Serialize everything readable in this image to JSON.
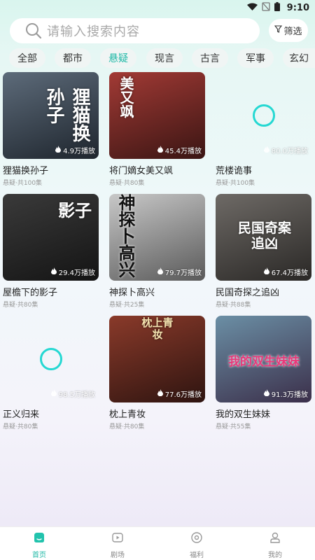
{
  "status_bar": {
    "time": "9:10"
  },
  "search": {
    "placeholder": "请输入搜索内容"
  },
  "filter": {
    "label": "筛选"
  },
  "tabs": [
    {
      "label": "全部"
    },
    {
      "label": "都市"
    },
    {
      "label": "悬疑",
      "active": true
    },
    {
      "label": "现言"
    },
    {
      "label": "古言"
    },
    {
      "label": "军事"
    },
    {
      "label": "玄幻"
    }
  ],
  "dramas": [
    {
      "title": "狸猫换孙子",
      "meta": "悬疑·共100集",
      "plays": "4.9万播放",
      "poster_text": "狸猫换孙子",
      "colors": [
        "#5d6b7a",
        "#1e252d"
      ]
    },
    {
      "title": "将门嫡女美又飒",
      "meta": "悬疑·共80集",
      "plays": "45.4万播放",
      "poster_text": "美又飒",
      "colors": [
        "#a23a35",
        "#3a1513"
      ]
    },
    {
      "title": "荒楼诡事",
      "meta": "悬疑·共100集",
      "plays": "80.0万播放",
      "poster_text": "",
      "loading": true
    },
    {
      "title": "屋檐下的影子",
      "meta": "悬疑·共80集",
      "plays": "29.4万播放",
      "poster_text": "影子",
      "colors": [
        "#3a3a3a",
        "#141414"
      ]
    },
    {
      "title": "神探卜高兴",
      "meta": "悬疑·共25集",
      "plays": "79.7万播放",
      "poster_text": "神探卜高兴",
      "colors": [
        "#c8c8c8",
        "#5a5a5a"
      ]
    },
    {
      "title": "民国奇探之追凶",
      "meta": "悬疑·共88集",
      "plays": "67.4万播放",
      "poster_text": "民国奇案 追凶",
      "colors": [
        "#6e6a66",
        "#2a2826"
      ]
    },
    {
      "title": "正义归来",
      "meta": "悬疑·共80集",
      "plays": "98.5万播放",
      "poster_text": "",
      "loading": true
    },
    {
      "title": "枕上青妆",
      "meta": "悬疑·共80集",
      "plays": "77.6万播放",
      "poster_text": "枕上青妆",
      "colors": [
        "#8a3a2a",
        "#2e1410"
      ]
    },
    {
      "title": "我的双生妹妹",
      "meta": "悬疑·共55集",
      "plays": "91.3万播放",
      "poster_text": "我的双生妹妹",
      "colors": [
        "#6b8fa5",
        "#3b2f4a"
      ]
    }
  ],
  "bottom_nav": [
    {
      "label": "首页",
      "icon": "home-icon",
      "active": true
    },
    {
      "label": "剧场",
      "icon": "theater-icon"
    },
    {
      "label": "福利",
      "icon": "welfare-icon"
    },
    {
      "label": "我的",
      "icon": "profile-icon"
    }
  ],
  "colors": {
    "accent": "#1fb8a6",
    "loader": "#25d8d2"
  }
}
